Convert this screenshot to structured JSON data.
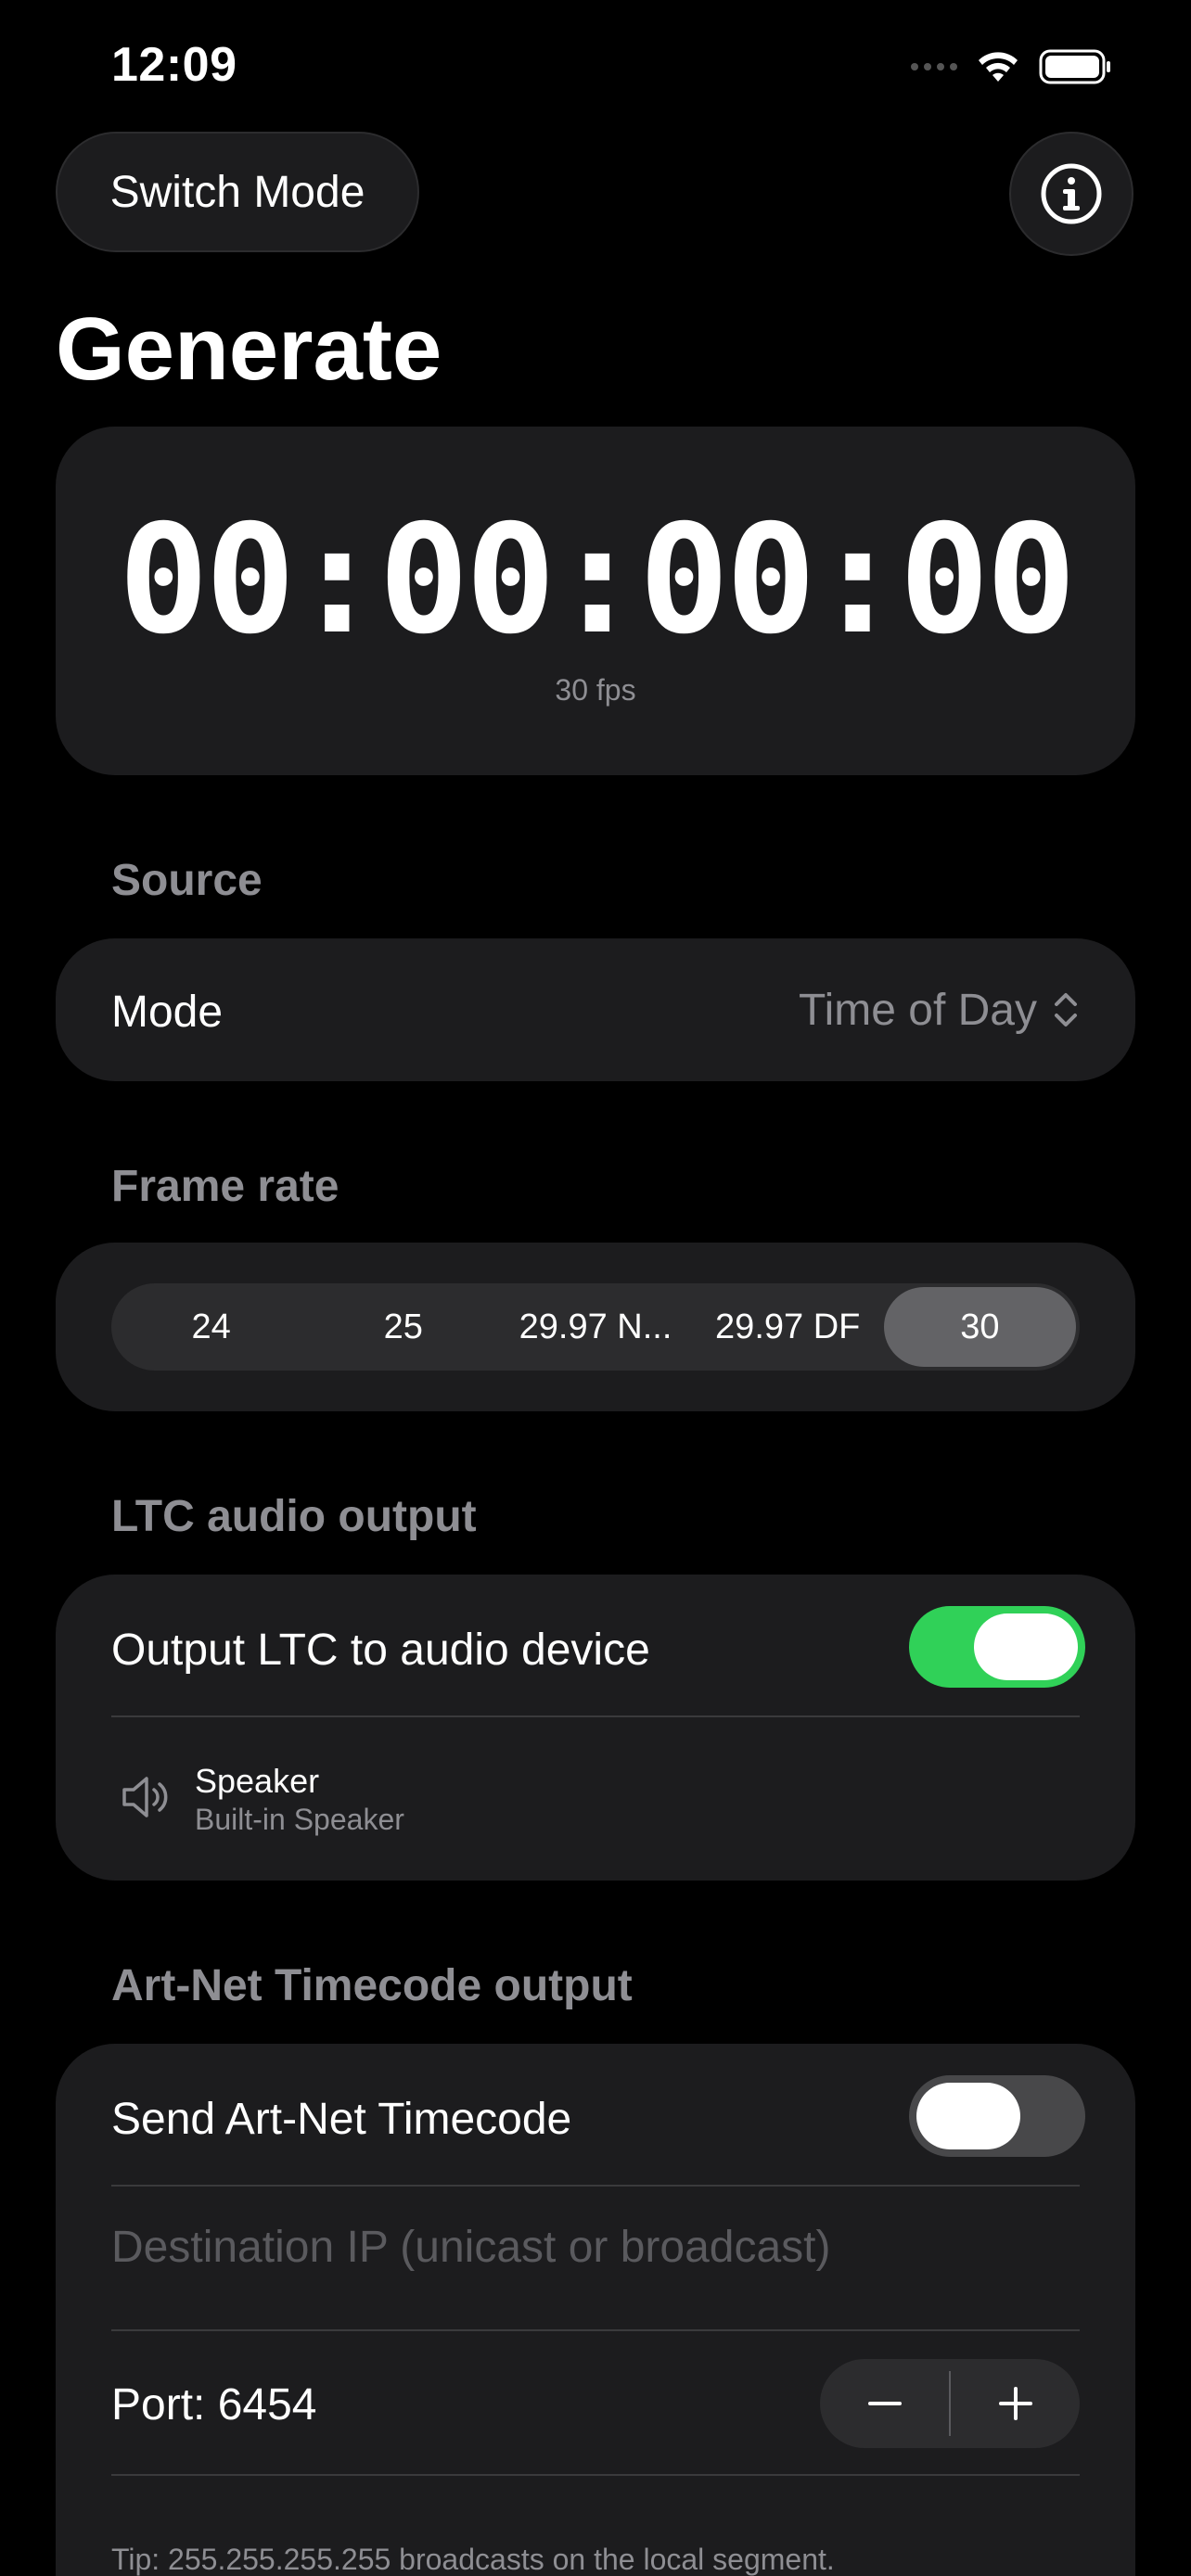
{
  "status_bar": {
    "time": "12:09"
  },
  "header": {
    "switch_mode_label": "Switch Mode",
    "title": "Generate"
  },
  "timecode": {
    "value": "00:00:00:00",
    "fps_label": "30 fps"
  },
  "source": {
    "section_label": "Source",
    "mode_label": "Mode",
    "mode_value": "Time of Day"
  },
  "frame_rate": {
    "section_label": "Frame rate",
    "options": [
      "24",
      "25",
      "29.97 N...",
      "29.97 DF",
      "30"
    ],
    "selected": "30"
  },
  "ltc": {
    "section_label": "LTC audio output",
    "toggle_label": "Output LTC to audio device",
    "enabled": true,
    "device_name": "Speaker",
    "device_sub": "Built-in Speaker"
  },
  "artnet": {
    "section_label": "Art-Net Timecode output",
    "toggle_label": "Send Art-Net Timecode",
    "enabled": false,
    "ip_value": "",
    "ip_placeholder": "Destination IP (unicast or broadcast)",
    "port_label": "Port: 6454",
    "tip": "Tip: 255.255.255.255 broadcasts on the local segment."
  },
  "colors": {
    "background": "#000000",
    "card": "#1c1c1e",
    "toggle_on": "#30d158",
    "toggle_off": "#48484a",
    "secondary_text": "#8e8e93"
  },
  "icons": [
    "cellular-icon",
    "wifi-icon",
    "battery-icon",
    "info-icon",
    "chevron-up-down-icon",
    "speaker-icon",
    "minus-icon",
    "plus-icon"
  ]
}
